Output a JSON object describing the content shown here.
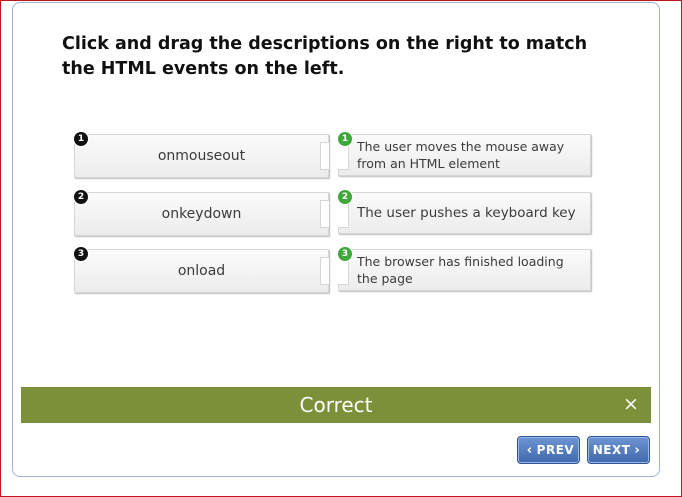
{
  "question": "Click and drag the descriptions on the right to match the HTML events on the left.",
  "pairs": [
    {
      "number": "1",
      "term": "onmouseout",
      "description": "The user moves the mouse away from an HTML element"
    },
    {
      "number": "2",
      "term": "onkeydown",
      "description": "The user pushes a keyboard key"
    },
    {
      "number": "3",
      "term": "onload",
      "description": "The browser has finished loading the page"
    }
  ],
  "feedback": {
    "label": "Correct",
    "close_icon": "×"
  },
  "nav": {
    "prev_label": "PREV",
    "next_label": "NEXT",
    "prev_icon": "‹",
    "next_icon": "›"
  },
  "colors": {
    "feedback_bar": "#7c903a",
    "nav_button": "#4a72b8",
    "badge_correct": "#3ea93a",
    "frame_border": "#c0161b"
  }
}
